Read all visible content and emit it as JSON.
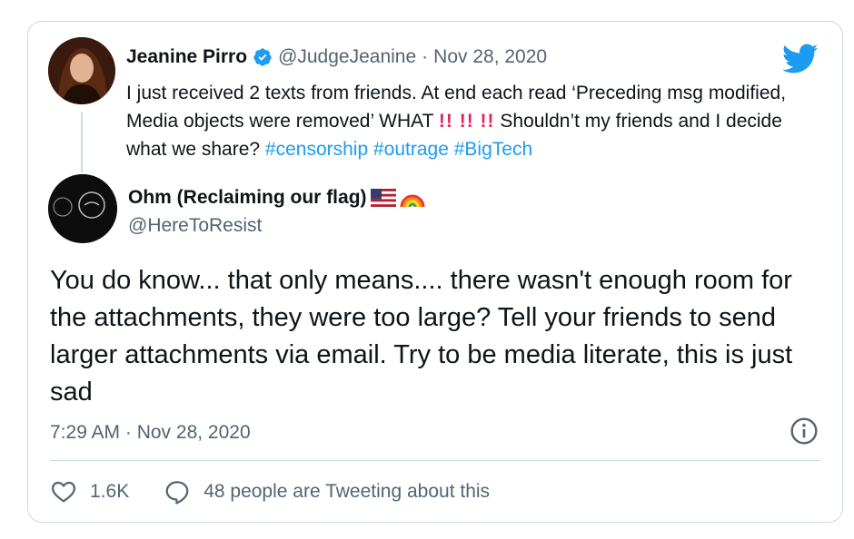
{
  "quoted": {
    "name": "Jeanine Pirro",
    "handle": "@JudgeJeanine",
    "separator": "·",
    "date": "Nov 28, 2020",
    "text_1": "I just received 2 texts from friends. At end each read ‘Preceding msg modified, Media objects were removed’  WHAT ",
    "bangs": "!! !! !!",
    "text_2": " Shouldn’t my friends and I decide what we share? ",
    "hashtags": [
      "#censorship",
      "#outrage",
      "#BigTech"
    ]
  },
  "reply": {
    "name": "Ohm (Reclaiming our flag)",
    "handle": "@HereToResist",
    "body": "You do know... that only means.... there wasn't enough room for the attachments, they were too large?  Tell your friends to send larger attachments via email.  Try to be media literate, this is just sad",
    "timestamp": "7:29 AM · Nov 28, 2020"
  },
  "actions": {
    "likes": "1.6K",
    "tweeting": "48 people are Tweeting about this"
  },
  "colors": {
    "accent": "#1d9bf0",
    "muted": "#536471",
    "border": "#cfd9de"
  },
  "icons": [
    "verified-badge-icon",
    "twitter-bird-icon",
    "info-icon",
    "heart-icon",
    "speech-bubble-icon",
    "us-flag-icon",
    "rainbow-icon"
  ]
}
